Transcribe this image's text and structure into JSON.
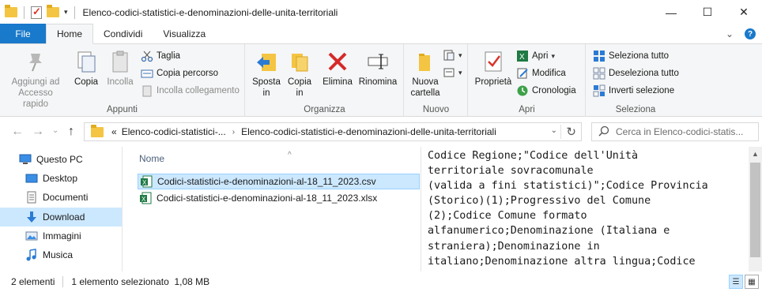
{
  "window": {
    "title": "Elenco-codici-statistici-e-denominazioni-delle-unita-territoriali",
    "minimize": "—",
    "maximize": "☐",
    "close": "✕"
  },
  "ribbon_tabs": {
    "file": "File",
    "items": [
      "Home",
      "Condividi",
      "Visualizza"
    ],
    "active": "Home"
  },
  "ribbon": {
    "appunti": {
      "label": "Appunti",
      "pin": "Aggiungi ad\nAccesso rapido",
      "copy": "Copia",
      "paste": "Incolla",
      "cut": "Taglia",
      "copy_path": "Copia percorso",
      "paste_link": "Incolla collegamento"
    },
    "organizza": {
      "label": "Organizza",
      "move": "Sposta\nin",
      "copy_to": "Copia\nin",
      "delete": "Elimina",
      "rename": "Rinomina"
    },
    "nuovo": {
      "label": "Nuovo",
      "new_folder": "Nuova\ncartella"
    },
    "apri": {
      "label": "Apri",
      "properties": "Proprietà",
      "open": "Apri",
      "edit": "Modifica",
      "history": "Cronologia"
    },
    "seleziona": {
      "label": "Seleziona",
      "select_all": "Seleziona tutto",
      "select_none": "Deseleziona tutto",
      "invert": "Inverti selezione"
    }
  },
  "address": {
    "prefix": "«",
    "parent": "Elenco-codici-statistici-...",
    "current": "Elenco-codici-statistici-e-denominazioni-delle-unita-territoriali",
    "search_placeholder": "Cerca in Elenco-codici-statis..."
  },
  "nav_pane": {
    "items": [
      {
        "label": "Questo PC",
        "icon": "pc-icon"
      },
      {
        "label": "Desktop",
        "icon": "desktop-icon"
      },
      {
        "label": "Documenti",
        "icon": "documents-icon"
      },
      {
        "label": "Download",
        "icon": "download-icon"
      },
      {
        "label": "Immagini",
        "icon": "pictures-icon"
      },
      {
        "label": "Musica",
        "icon": "music-icon"
      }
    ],
    "selected": "Download"
  },
  "file_list": {
    "column_name": "Nome",
    "files": [
      {
        "name": "Codici-statistici-e-denominazioni-al-18_11_2023.csv",
        "selected": true
      },
      {
        "name": "Codici-statistici-e-denominazioni-al-18_11_2023.xlsx",
        "selected": false
      }
    ]
  },
  "preview": {
    "text": "Codice Regione;\"Codice dell'Unità\nterritoriale sovracomunale\n(valida a fini statistici)\";Codice Provincia\n(Storico)(1);Progressivo del Comune\n(2);Codice Comune formato\nalfanumerico;Denominazione (Italiana e\nstraniera);Denominazione in\nitaliano;Denominazione altra lingua;Codice\nRipartizione Geografica;Ripartizione"
  },
  "status": {
    "count": "2 elementi",
    "selection": "1 elemento selezionato  1,08 MB"
  },
  "colors": {
    "accent": "#1979ca",
    "selection": "#cce8ff"
  }
}
